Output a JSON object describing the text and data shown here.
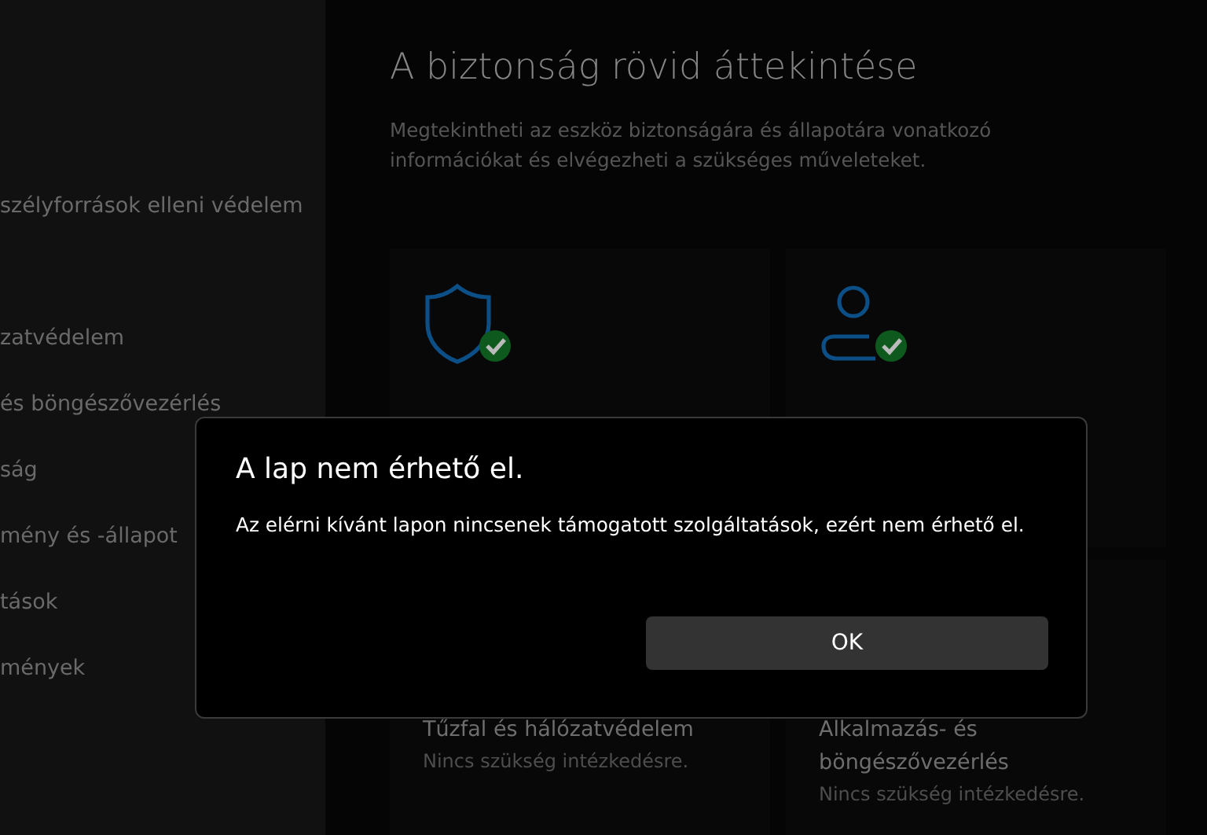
{
  "sidebar": {
    "items": [
      {
        "label": "szélyforrások elleni védelem"
      },
      {
        "label": "zatvédelem"
      },
      {
        "label": "és böngészővezérlés"
      },
      {
        "label": "ság"
      },
      {
        "label": "mény és -állapot"
      },
      {
        "label": "tások"
      },
      {
        "label": "mények"
      }
    ]
  },
  "main": {
    "title": "A biztonság rövid áttekintése",
    "subtitle": "Megtekintheti az eszköz biztonságára és állapotára vonatkozó információkat és elvégezheti a szükséges műveleteket.",
    "tiles": [
      {
        "kind": "shield"
      },
      {
        "kind": "person"
      },
      {
        "kind": "none",
        "title": "Tűzfal és hálózatvédelem",
        "status": "Nincs szükség intézkedésre."
      },
      {
        "kind": "none",
        "title": "Alkalmazás- és böngészővezérlés",
        "status": "Nincs szükség intézkedésre."
      }
    ]
  },
  "dialog": {
    "title": "A lap nem érhető el.",
    "message": "Az elérni kívánt lapon nincsenek támogatott szolgáltatások, ezért nem érhető el.",
    "buttons": [
      "OK"
    ]
  }
}
